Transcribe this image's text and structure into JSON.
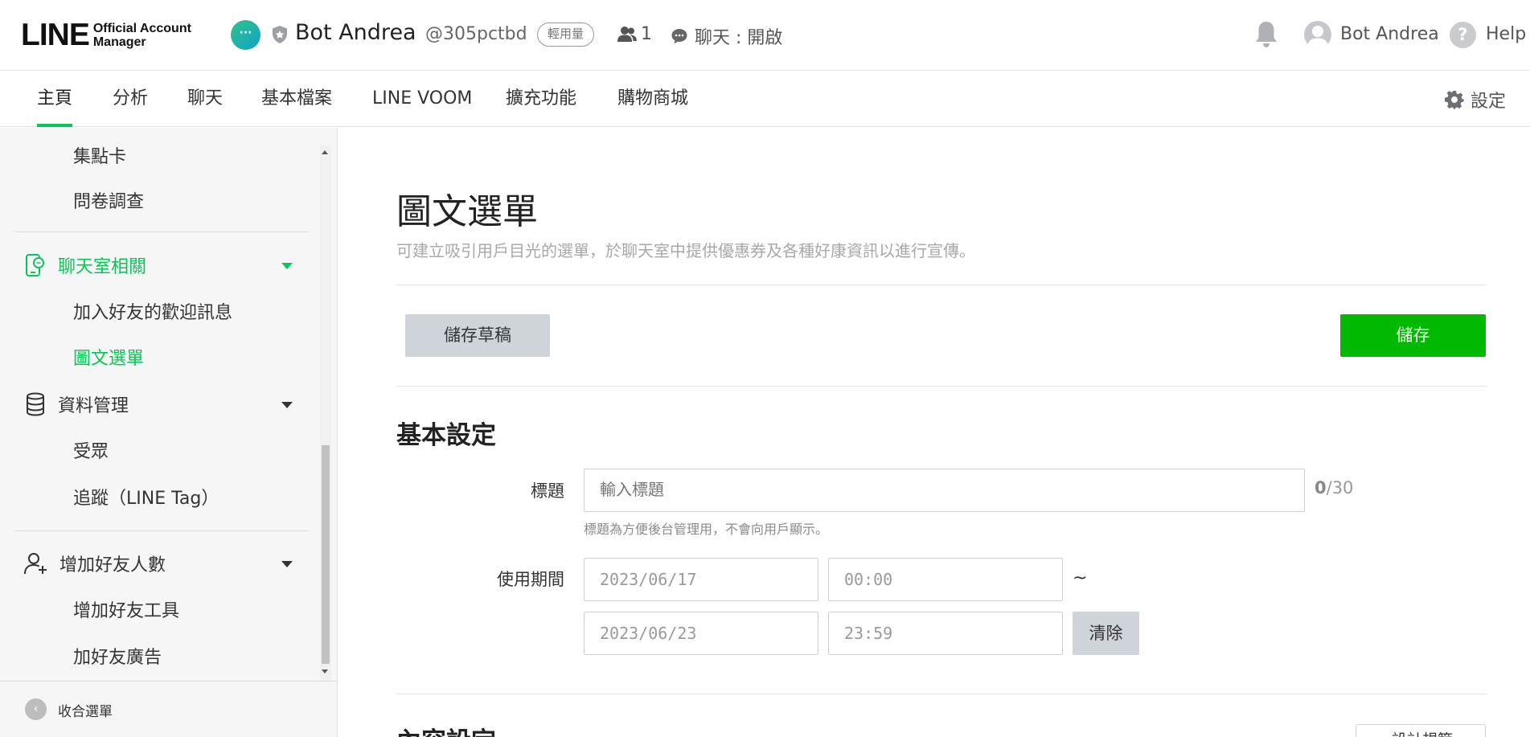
{
  "header": {
    "logo_main": "LINE",
    "logo_sub_line1": "Official Account",
    "logo_sub_line2": "Manager",
    "account_avatar_glyph": "···",
    "account_name": "Bot Andrea",
    "account_id": "@305pctbd",
    "plan_badge": "輕用量",
    "friend_count": "1",
    "chat_status": "聊天 : 開啟",
    "user_name": "Bot Andrea",
    "help_glyph": "?",
    "help_label": "Help",
    "icons": [
      "shield-icon",
      "friends-icon",
      "chat-bubble-icon",
      "bell-icon",
      "user-avatar-icon",
      "help-icon"
    ]
  },
  "nav": {
    "tabs": [
      {
        "label": "主頁",
        "active": true
      },
      {
        "label": "分析"
      },
      {
        "label": "聊天"
      },
      {
        "label": "基本檔案"
      },
      {
        "label": "LINE VOOM"
      },
      {
        "label": "擴充功能"
      },
      {
        "label": "購物商城"
      }
    ],
    "settings_label": "設定"
  },
  "sidebar": {
    "items": [
      {
        "label": "集點卡",
        "type": "sub"
      },
      {
        "label": "問卷調查",
        "type": "sub"
      },
      {
        "label": "聊天室相關",
        "type": "group",
        "icon": "chat-room-icon",
        "active": true
      },
      {
        "label": "加入好友的歡迎訊息",
        "type": "sub"
      },
      {
        "label": "圖文選單",
        "type": "sub",
        "active": true
      },
      {
        "label": "資料管理",
        "type": "group",
        "icon": "database-icon"
      },
      {
        "label": "受眾",
        "type": "sub"
      },
      {
        "label": "追蹤（LINE Tag）",
        "type": "sub"
      },
      {
        "label": "增加好友人數",
        "type": "group",
        "icon": "add-friend-icon"
      },
      {
        "label": "增加好友工具",
        "type": "sub"
      },
      {
        "label": "加好友廣告",
        "type": "sub"
      }
    ],
    "collapse_label": "收合選單",
    "collapse_glyph": "‹"
  },
  "main": {
    "title": "圖文選單",
    "description": "可建立吸引用戶目光的選單，於聊天室中提供優惠券及各種好康資訊以進行宣傳。",
    "save_draft_label": "儲存草稿",
    "save_label": "儲存",
    "basic_settings_title": "基本設定",
    "title_field": {
      "label": "標題",
      "placeholder": "輸入標題",
      "value": "",
      "count": "0",
      "max": "/30",
      "hint": "標題為方便後台管理用，不會向用戶顯示。"
    },
    "period_field": {
      "label": "使用期間",
      "start_date": "2023/06/17",
      "start_time": "00:00",
      "separator": "~",
      "end_date": "2023/06/23",
      "end_time": "23:59",
      "clear_label": "清除"
    },
    "content_settings_title": "內容設定",
    "design_guide_label": "設計規範"
  },
  "colors": {
    "accent_green": "#06c755",
    "save_green": "#00b900",
    "gray_button": "#cfd3da"
  }
}
